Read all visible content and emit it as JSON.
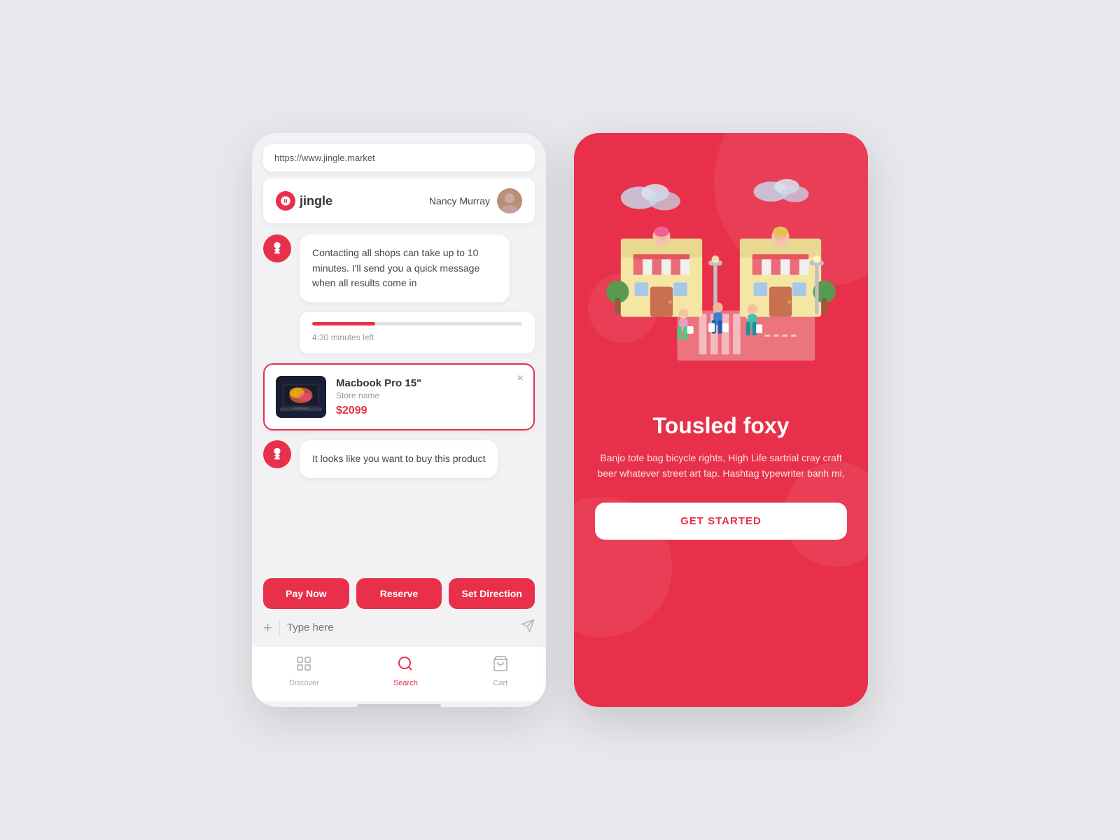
{
  "left": {
    "url": "https://www.jingle.market",
    "logo_text": "jingle",
    "user_name": "Nancy Murray",
    "messages": [
      {
        "id": "msg1",
        "text": "Contacting all shops can take up to 10 minutes. I'll send you a quick message when all results come in"
      },
      {
        "id": "msg2",
        "text": "It looks like you want to buy this product"
      }
    ],
    "progress": {
      "percent": 30,
      "label": "4:30 minutes left"
    },
    "product": {
      "name": "Macbook Pro 15\"",
      "store": "Store name",
      "price": "$2099"
    },
    "buttons": [
      {
        "id": "pay-now",
        "label": "Pay Now"
      },
      {
        "id": "reserve",
        "label": "Reserve"
      },
      {
        "id": "set-direction",
        "label": "Set Direction"
      }
    ],
    "input_placeholder": "Type here",
    "nav": [
      {
        "id": "discover",
        "label": "Discover",
        "active": false
      },
      {
        "id": "search",
        "label": "Search",
        "active": true
      },
      {
        "id": "cart",
        "label": "Cart",
        "active": false
      }
    ]
  },
  "right": {
    "title": "Tousled foxy",
    "description": "Banjo tote bag bicycle rights, High Life sartrial cray craft beer whatever street art fap. Hashtag typewriter banh mi,",
    "cta_label": "GET STARTED"
  }
}
